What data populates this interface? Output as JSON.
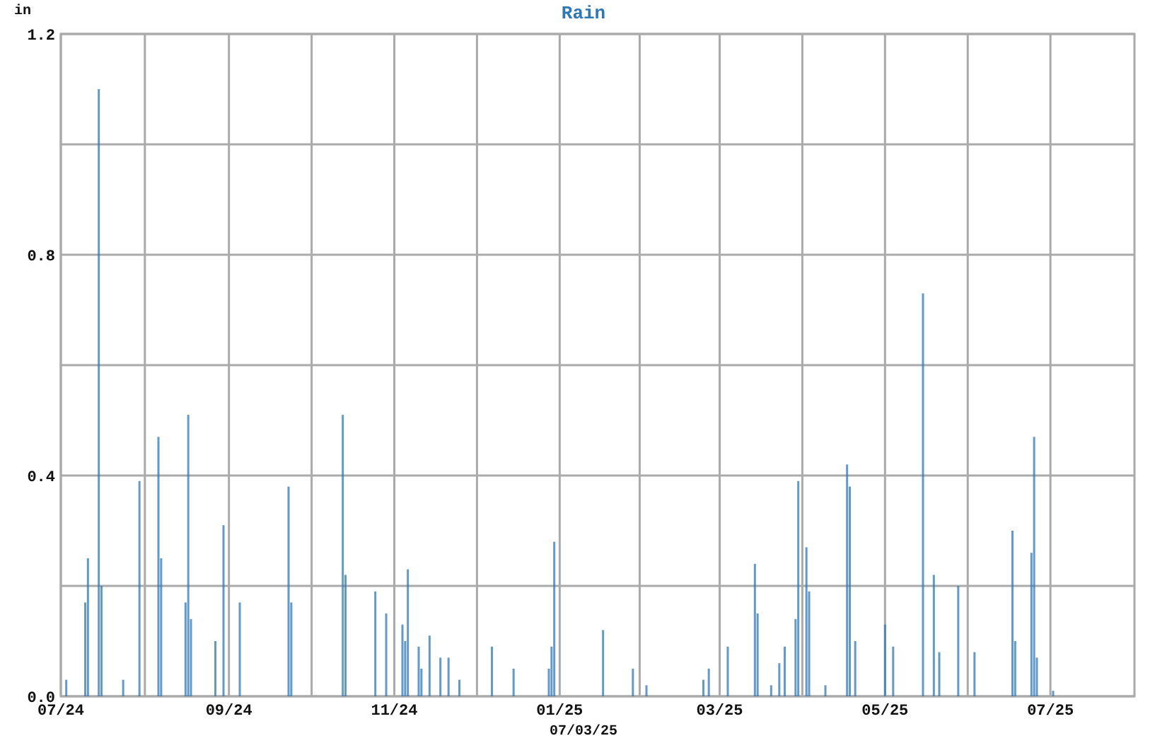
{
  "date": "07/03/25",
  "chart_data": {
    "type": "bar",
    "title": "Rain",
    "ylabel": "in",
    "ylim": [
      0,
      1.2
    ],
    "yticks": [
      {
        "value": 0,
        "label": "0.0"
      },
      {
        "value": 0.4,
        "label": "0.4"
      },
      {
        "value": 0.8,
        "label": "0.8"
      },
      {
        "value": 1.2,
        "label": "1.2"
      }
    ],
    "categories": [
      "07/24",
      null,
      null,
      null,
      null,
      null,
      null,
      null,
      null,
      null,
      null,
      null,
      null,
      null,
      null,
      null,
      null,
      null,
      null,
      null,
      null,
      null,
      null,
      null,
      null,
      null,
      null,
      null,
      null,
      null,
      null,
      null,
      null,
      null,
      null,
      null,
      null,
      null,
      null,
      null,
      null,
      null,
      null,
      null,
      null,
      null,
      null,
      null,
      null,
      null,
      null,
      null,
      null,
      null,
      null,
      null,
      null,
      null,
      null,
      null,
      null,
      null,
      "09/24",
      null,
      null,
      null,
      null,
      null,
      null,
      null,
      null,
      null,
      null,
      null,
      null,
      null,
      null,
      null,
      null,
      null,
      null,
      null,
      null,
      null,
      null,
      null,
      null,
      null,
      null,
      null,
      null,
      null,
      null,
      null,
      null,
      null,
      null,
      null,
      null,
      null,
      null,
      null,
      null,
      null,
      null,
      null,
      null,
      null,
      null,
      null,
      null,
      null,
      null,
      null,
      null,
      null,
      null,
      null,
      null,
      null,
      null,
      null,
      null,
      "11/24",
      null,
      null,
      null,
      null,
      null,
      null,
      null,
      null,
      null,
      null,
      null,
      null,
      null,
      null,
      null,
      null,
      null,
      null,
      null,
      null,
      null,
      null,
      null,
      null,
      null,
      null,
      null,
      null,
      null,
      null,
      null,
      null,
      null,
      null,
      null,
      null,
      null,
      null,
      null,
      null,
      null,
      null,
      null,
      null,
      null,
      null,
      null,
      null,
      null,
      null,
      null,
      null,
      null,
      null,
      null,
      null,
      null,
      null,
      null,
      null,
      "01/25",
      null,
      null,
      null,
      null,
      null,
      null,
      null,
      null,
      null,
      null,
      null,
      null,
      null,
      null,
      null,
      null,
      null,
      null,
      null,
      null,
      null,
      null,
      null,
      null,
      null,
      null,
      null,
      null,
      null,
      null,
      null,
      null,
      null,
      null,
      null,
      null,
      null,
      null,
      null,
      null,
      null,
      null,
      null,
      null,
      null,
      null,
      null,
      null,
      null,
      null,
      null,
      null,
      null,
      null,
      null,
      null,
      null,
      null,
      "03/25",
      null,
      null,
      null,
      null,
      null,
      null,
      null,
      null,
      null,
      null,
      null,
      null,
      null,
      null,
      null,
      null,
      null,
      null,
      null,
      null,
      null,
      null,
      null,
      null,
      null,
      null,
      null,
      null,
      null,
      null,
      null,
      null,
      null,
      null,
      null,
      null,
      null,
      null,
      null,
      null,
      null,
      null,
      null,
      null,
      null,
      null,
      null,
      null,
      null,
      null,
      null,
      null,
      null,
      null,
      null,
      null,
      null,
      null,
      null,
      null,
      "05/25",
      null,
      null,
      null,
      null,
      null,
      null,
      null,
      null,
      null,
      null,
      null,
      null,
      null,
      null,
      null,
      null,
      null,
      null,
      null,
      null,
      null,
      null,
      null,
      null,
      null,
      null,
      null,
      null,
      null,
      null,
      null,
      null,
      null,
      null,
      null,
      null,
      null,
      null,
      null,
      null,
      null,
      null,
      null,
      null,
      null,
      null,
      null,
      null,
      null,
      null,
      null,
      null,
      null,
      null,
      null,
      null,
      null,
      null,
      null,
      null,
      "07/25",
      null,
      null,
      null,
      null,
      null,
      null,
      null,
      null,
      null,
      null,
      null,
      null,
      null,
      null,
      null,
      null,
      null,
      null,
      null,
      null,
      null,
      null,
      null,
      null,
      null,
      null,
      null,
      null,
      null,
      null
    ],
    "series": [
      {
        "color": "#2f78b8",
        "values": [
          null,
          null,
          0.03,
          null,
          null,
          null,
          null,
          null,
          null,
          0.17,
          0.25,
          null,
          null,
          null,
          1.1,
          0.2,
          null,
          null,
          null,
          null,
          null,
          null,
          null,
          0.03,
          null,
          null,
          null,
          null,
          null,
          0.39,
          null,
          null,
          null,
          null,
          null,
          null,
          0.47,
          0.25,
          null,
          null,
          null,
          null,
          null,
          null,
          null,
          null,
          0.17,
          0.51,
          0.14,
          null,
          null,
          null,
          null,
          null,
          null,
          null,
          null,
          0.1,
          null,
          null,
          0.31,
          null,
          null,
          null,
          null,
          null,
          0.17,
          null,
          null,
          null,
          null,
          null,
          null,
          null,
          null,
          null,
          null,
          null,
          null,
          null,
          null,
          null,
          null,
          null,
          0.38,
          0.17,
          null,
          null,
          null,
          null,
          null,
          null,
          null,
          null,
          null,
          null,
          null,
          null,
          null,
          null,
          null,
          null,
          null,
          null,
          0.51,
          0.22,
          null,
          null,
          null,
          null,
          null,
          null,
          null,
          null,
          null,
          null,
          0.19,
          null,
          null,
          null,
          0.15,
          null,
          null,
          null,
          null,
          null,
          0.13,
          0.1,
          0.23,
          null,
          null,
          null,
          0.09,
          0.05,
          null,
          null,
          0.11,
          null,
          null,
          null,
          0.07,
          null,
          null,
          0.07,
          null,
          null,
          null,
          0.03,
          null,
          null,
          null,
          null,
          null,
          null,
          null,
          null,
          null,
          null,
          null,
          0.09,
          null,
          null,
          null,
          null,
          null,
          null,
          null,
          0.05,
          null,
          null,
          null,
          null,
          null,
          null,
          null,
          null,
          null,
          null,
          null,
          null,
          0.05,
          0.09,
          0.28,
          null,
          null,
          null,
          null,
          null,
          null,
          null,
          null,
          null,
          null,
          null,
          null,
          null,
          null,
          null,
          null,
          null,
          0.12,
          null,
          null,
          null,
          null,
          null,
          null,
          null,
          null,
          null,
          null,
          0.05,
          null,
          null,
          null,
          null,
          0.02,
          null,
          null,
          null,
          null,
          null,
          null,
          null,
          null,
          null,
          null,
          null,
          null,
          null,
          null,
          null,
          null,
          null,
          null,
          null,
          null,
          0.03,
          null,
          0.05,
          null,
          null,
          null,
          null,
          null,
          null,
          0.09,
          null,
          null,
          null,
          null,
          null,
          null,
          null,
          null,
          null,
          0.24,
          0.15,
          null,
          null,
          null,
          null,
          0.02,
          null,
          null,
          0.06,
          null,
          0.09,
          null,
          null,
          null,
          0.14,
          0.39,
          null,
          null,
          0.27,
          0.19,
          null,
          null,
          null,
          null,
          null,
          0.02,
          null,
          null,
          null,
          null,
          null,
          null,
          null,
          0.42,
          0.38,
          null,
          0.1,
          null,
          null,
          null,
          null,
          null,
          null,
          null,
          null,
          null,
          null,
          0.13,
          null,
          null,
          0.09,
          null,
          null,
          null,
          null,
          null,
          null,
          null,
          null,
          null,
          null,
          0.73,
          null,
          null,
          null,
          0.22,
          null,
          0.08,
          null,
          null,
          null,
          null,
          null,
          null,
          0.2,
          null,
          null,
          null,
          null,
          null,
          0.08,
          null,
          null,
          null,
          null,
          null,
          null,
          null,
          null,
          null,
          null,
          null,
          null,
          null,
          0.3,
          0.1,
          null,
          null,
          null,
          null,
          null,
          0.26,
          0.47,
          0.07,
          null,
          null,
          null,
          null,
          null,
          0.01,
          null,
          null,
          null,
          null,
          null,
          null,
          null,
          null,
          null,
          null,
          null,
          null,
          null,
          null,
          null,
          null,
          null,
          null,
          null,
          null,
          null,
          null,
          null,
          null,
          null,
          null,
          null,
          null,
          null
        ]
      }
    ]
  }
}
